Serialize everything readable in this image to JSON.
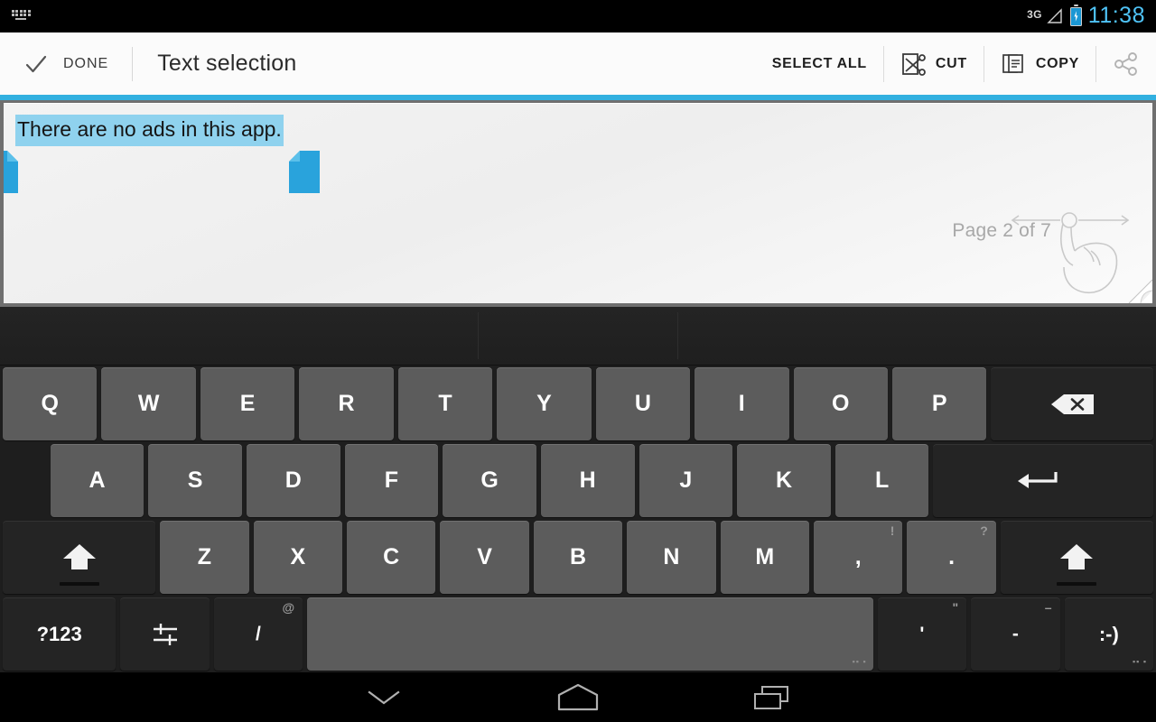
{
  "status_bar": {
    "keyboard_icon": "keyboard-icon",
    "network_label": "3G",
    "signal_icon": "signal-triangle-icon",
    "battery_icon": "battery-charging-icon",
    "clock": "11:38",
    "clock_color": "#4fc3f7",
    "battery_color": "#1b97d4"
  },
  "action_bar": {
    "done_icon": "check-icon",
    "done_label": "DONE",
    "title": "Text selection",
    "actions": [
      {
        "label": "SELECT ALL",
        "icon": "",
        "name": "select-all"
      },
      {
        "label": "CUT",
        "icon": "cut-icon",
        "name": "cut"
      },
      {
        "label": "COPY",
        "icon": "copy-icon",
        "name": "copy"
      },
      {
        "label": "",
        "icon": "share-icon",
        "name": "share"
      }
    ],
    "accent_color": "#32b0e0"
  },
  "document": {
    "selected_text": "There are no ads in this app.",
    "selection_highlight_color": "#8fd2ee",
    "handle_color": "#29a3dc",
    "page_indicator": "Page 2 of 7",
    "swipe_hint_icon": "swipe-hand-icon",
    "page_curl_icon": "page-curl-icon"
  },
  "keyboard": {
    "suggestions": [],
    "rows": [
      {
        "name": "row-1",
        "keys": [
          {
            "label": "Q",
            "name": "key-q",
            "style": "light"
          },
          {
            "label": "W",
            "name": "key-w",
            "style": "light"
          },
          {
            "label": "E",
            "name": "key-e",
            "style": "light"
          },
          {
            "label": "R",
            "name": "key-r",
            "style": "light"
          },
          {
            "label": "T",
            "name": "key-t",
            "style": "light"
          },
          {
            "label": "Y",
            "name": "key-y",
            "style": "light"
          },
          {
            "label": "U",
            "name": "key-u",
            "style": "light"
          },
          {
            "label": "I",
            "name": "key-i",
            "style": "light"
          },
          {
            "label": "O",
            "name": "key-o",
            "style": "light"
          },
          {
            "label": "P",
            "name": "key-p",
            "style": "light"
          },
          {
            "label": "",
            "name": "key-backspace",
            "style": "dark",
            "icon": "backspace-icon"
          }
        ]
      },
      {
        "name": "row-2",
        "keys": [
          {
            "label": "A",
            "name": "key-a",
            "style": "light"
          },
          {
            "label": "S",
            "name": "key-s",
            "style": "light"
          },
          {
            "label": "D",
            "name": "key-d",
            "style": "light"
          },
          {
            "label": "F",
            "name": "key-f",
            "style": "light"
          },
          {
            "label": "G",
            "name": "key-g",
            "style": "light"
          },
          {
            "label": "H",
            "name": "key-h",
            "style": "light"
          },
          {
            "label": "J",
            "name": "key-j",
            "style": "light"
          },
          {
            "label": "K",
            "name": "key-k",
            "style": "light"
          },
          {
            "label": "L",
            "name": "key-l",
            "style": "light"
          },
          {
            "label": "",
            "name": "key-enter",
            "style": "dark",
            "icon": "enter-icon"
          }
        ]
      },
      {
        "name": "row-3",
        "keys": [
          {
            "label": "",
            "name": "key-shift-left",
            "style": "dark",
            "icon": "shift-icon"
          },
          {
            "label": "Z",
            "name": "key-z",
            "style": "light"
          },
          {
            "label": "X",
            "name": "key-x",
            "style": "light"
          },
          {
            "label": "C",
            "name": "key-c",
            "style": "light"
          },
          {
            "label": "V",
            "name": "key-v",
            "style": "light"
          },
          {
            "label": "B",
            "name": "key-b",
            "style": "light"
          },
          {
            "label": "N",
            "name": "key-n",
            "style": "light"
          },
          {
            "label": "M",
            "name": "key-m",
            "style": "light"
          },
          {
            "label": ",",
            "name": "key-comma",
            "style": "light",
            "hint": "!"
          },
          {
            "label": ".",
            "name": "key-period",
            "style": "light",
            "hint": "?"
          },
          {
            "label": "",
            "name": "key-shift-right",
            "style": "dark",
            "icon": "shift-icon"
          }
        ]
      },
      {
        "name": "row-4",
        "keys": [
          {
            "label": "?123",
            "name": "key-symbols",
            "style": "dark"
          },
          {
            "label": "",
            "name": "key-settings",
            "style": "dark",
            "icon": "settings-sliders-icon"
          },
          {
            "label": "/",
            "name": "key-slash",
            "style": "dark",
            "hint": "@"
          },
          {
            "label": "",
            "name": "key-space",
            "style": "light",
            "dots": "▪▪ ▪"
          },
          {
            "label": "'",
            "name": "key-apostrophe",
            "style": "dark",
            "hint": "\""
          },
          {
            "label": "-",
            "name": "key-dash",
            "style": "dark",
            "hint": "–"
          },
          {
            "label": ":-)",
            "name": "key-emoticon",
            "style": "dark",
            "dots": "▪▪ ▪"
          }
        ]
      }
    ]
  },
  "nav_bar": {
    "back_icon": "chevron-down-icon",
    "home_icon": "home-icon",
    "recents_icon": "recents-icon"
  }
}
